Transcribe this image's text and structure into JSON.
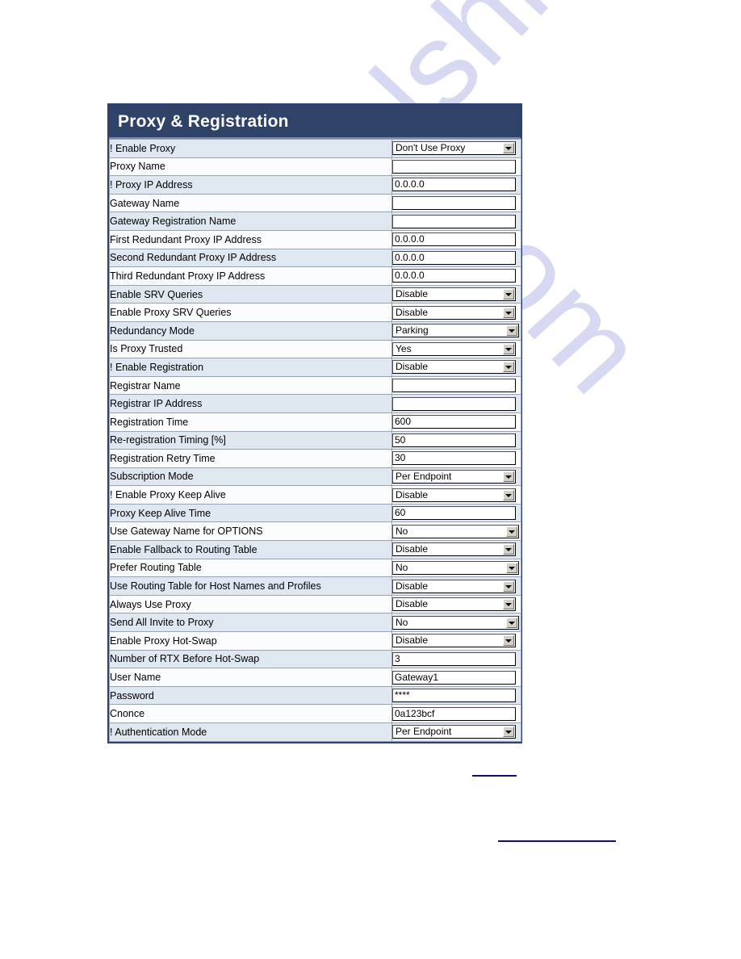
{
  "panel": {
    "title": "Proxy & Registration",
    "rows": [
      {
        "label": "! Enable Proxy",
        "type": "select",
        "value": "Don't Use Proxy"
      },
      {
        "label": "Proxy Name",
        "type": "text",
        "value": ""
      },
      {
        "label": "! Proxy IP Address",
        "type": "text",
        "value": "0.0.0.0"
      },
      {
        "label": "Gateway Name",
        "type": "text",
        "value": ""
      },
      {
        "label": "Gateway Registration Name",
        "type": "text",
        "value": ""
      },
      {
        "label": "First Redundant Proxy IP Address",
        "type": "text",
        "value": "0.0.0.0"
      },
      {
        "label": "Second Redundant Proxy IP Address",
        "type": "text",
        "value": "0.0.0.0"
      },
      {
        "label": "Third Redundant Proxy IP Address",
        "type": "text",
        "value": "0.0.0.0"
      },
      {
        "label": "Enable SRV Queries",
        "type": "select",
        "value": "Disable"
      },
      {
        "label": "Enable Proxy SRV Queries",
        "type": "select",
        "value": "Disable"
      },
      {
        "label": "Redundancy Mode",
        "type": "select",
        "value": "Parking",
        "wide": true
      },
      {
        "label": "Is Proxy Trusted",
        "type": "select",
        "value": "Yes"
      },
      {
        "label": "! Enable Registration",
        "type": "select",
        "value": "Disable"
      },
      {
        "label": "Registrar Name",
        "type": "text",
        "value": ""
      },
      {
        "label": "Registrar IP Address",
        "type": "text",
        "value": ""
      },
      {
        "label": "Registration Time",
        "type": "text",
        "value": "600"
      },
      {
        "label": "Re-registration Timing [%]",
        "type": "text",
        "value": "50"
      },
      {
        "label": "Registration Retry Time",
        "type": "text",
        "value": "30"
      },
      {
        "label": "Subscription Mode",
        "type": "select",
        "value": "Per Endpoint"
      },
      {
        "label": "! Enable Proxy Keep Alive",
        "type": "select",
        "value": "Disable"
      },
      {
        "label": "Proxy Keep Alive Time",
        "type": "text",
        "value": "60"
      },
      {
        "label": "Use Gateway Name for OPTIONS",
        "type": "select",
        "value": "No",
        "wide": true
      },
      {
        "label": "Enable Fallback to Routing Table",
        "type": "select",
        "value": "Disable"
      },
      {
        "label": "Prefer Routing Table",
        "type": "select",
        "value": "No",
        "wide": true
      },
      {
        "label": "Use Routing Table for Host Names and Profiles",
        "type": "select",
        "value": "Disable"
      },
      {
        "label": "Always Use Proxy",
        "type": "select",
        "value": "Disable"
      },
      {
        "label": "Send All Invite to Proxy",
        "type": "select",
        "value": "No",
        "wide": true
      },
      {
        "label": "Enable Proxy Hot-Swap",
        "type": "select",
        "value": "Disable"
      },
      {
        "label": "Number of RTX Before Hot-Swap",
        "type": "text",
        "value": "3"
      },
      {
        "label": "User Name",
        "type": "text",
        "value": "Gateway1"
      },
      {
        "label": "Password",
        "type": "text",
        "value": "****"
      },
      {
        "label": "Cnonce",
        "type": "text",
        "value": "0a123bcf"
      },
      {
        "label": "! Authentication Mode",
        "type": "select",
        "value": "Per Endpoint"
      }
    ]
  },
  "watermark": {
    "line1": "com",
    "line2": "manualshive."
  },
  "colors": {
    "header_bg": "#2f4268",
    "panel_border": "#2e3f72",
    "row_odd": "#dfe7f1",
    "row_even": "#fbfcfe",
    "rule": "#0f0f78"
  }
}
